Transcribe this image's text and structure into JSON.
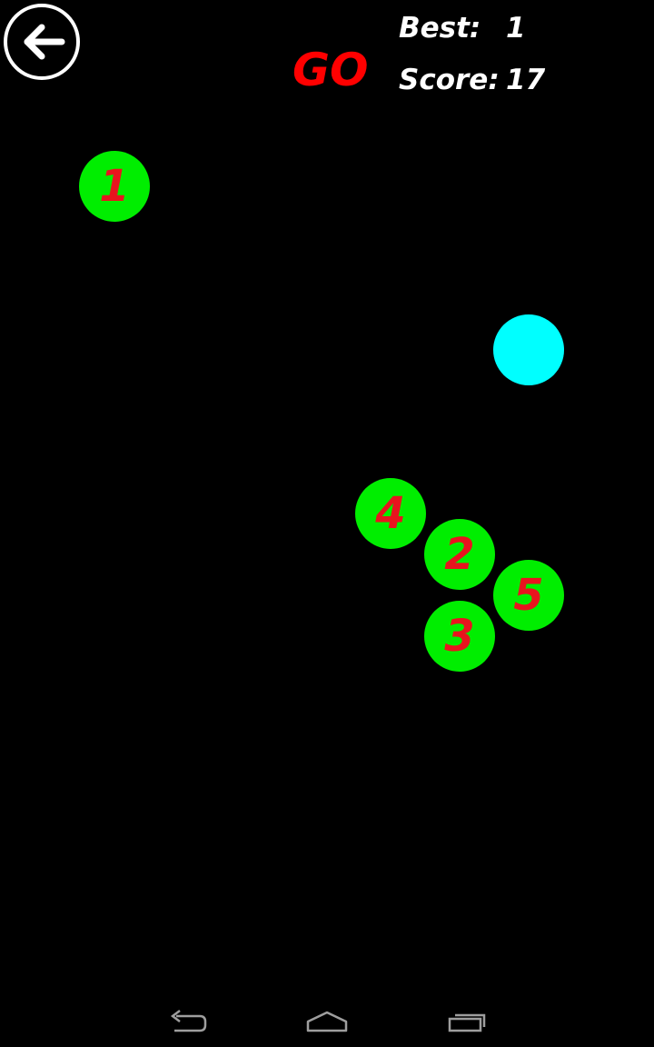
{
  "header": {
    "status_text": "GO",
    "best_label": "Best:",
    "best_value": "1",
    "score_label": "Score:",
    "score_value": "17"
  },
  "balls": [
    {
      "label": "1"
    },
    {
      "label": "4"
    },
    {
      "label": "2"
    },
    {
      "label": "5"
    },
    {
      "label": "3"
    }
  ],
  "icons": {
    "back": "arrow-left-icon",
    "nav_back": "nav-back-icon",
    "nav_home": "nav-home-icon",
    "nav_recent": "nav-recent-apps-icon"
  },
  "colors": {
    "background": "#000000",
    "ball_fill": "#00ee00",
    "ball_number": "#e8141e",
    "player_ball": "#00ffff",
    "status_text": "#ff0000",
    "stats_text": "#ffffff",
    "nav_icon": "#9e9e9e"
  }
}
